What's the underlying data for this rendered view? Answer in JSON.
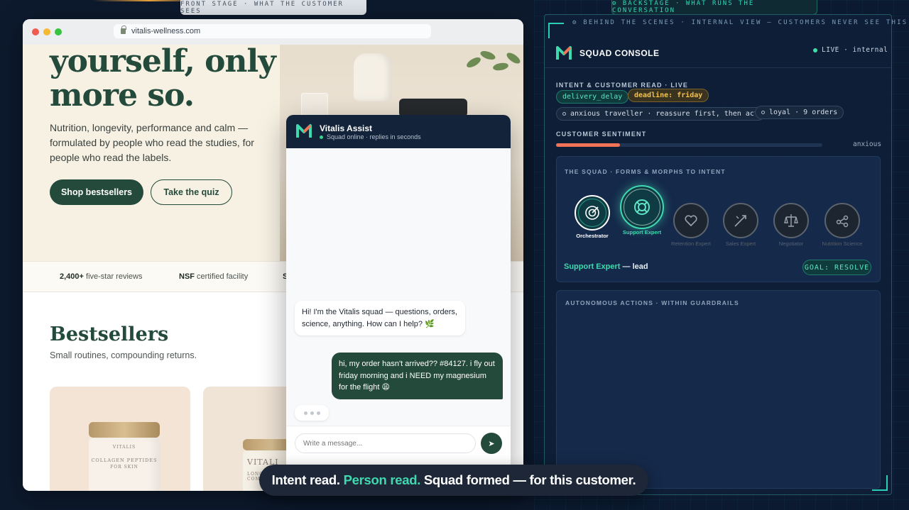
{
  "stage": {
    "front_label": "FRONT STAGE · WHAT THE CUSTOMER SEES",
    "back_label": "⚙ BACKSTAGE · WHAT RUNS THE CONVERSATION"
  },
  "browser": {
    "url": "vitalis-wellness.com"
  },
  "hero": {
    "title_line1": "yourself, only",
    "title_line2": "more so.",
    "copy": "Nutrition, longevity, performance and calm — formulated by people who read the studies, for people who read the labels.",
    "primary_cta": "Shop bestsellers",
    "secondary_cta": "Take the quiz"
  },
  "trust": {
    "reviews_bold": "2,400+",
    "reviews_text": " five-star reviews",
    "nsf_bold": "NSF",
    "nsf_text": " certified facility",
    "third_partial": "S"
  },
  "bestsellers": {
    "title": "Bestsellers",
    "subtitle": "Small routines, compounding returns.",
    "products": [
      {
        "brand": "VITALIS",
        "name": "COLLAGEN PEPTIDES",
        "sub": "FOR SKIN"
      },
      {
        "brand": "VITALI",
        "name": "LONGEVITY COMPL"
      }
    ]
  },
  "chat": {
    "name": "Vitalis Assist",
    "status": "Squad online · replies in seconds",
    "bot_message": "Hi! I'm the Vitalis squad — questions, orders, science, anything. How can I help? 🌿",
    "user_message": "hi, my order hasn't arrived?? #84127. i fly out friday morning and i NEED my magnesium for the flight 😩",
    "input_placeholder": "Write a message...",
    "send_icon": "➤"
  },
  "caption": {
    "part1": "Intent read.",
    "part2": "Person read.",
    "part3": "Squad formed — for this customer."
  },
  "console": {
    "behind_label": "⚙ BEHIND THE SCENES · INTERNAL VIEW — CUSTOMERS NEVER SEE THIS",
    "title": "SQUAD CONSOLE",
    "live": "LIVE · internal",
    "intent_label": "INTENT & CUSTOMER READ · LIVE",
    "chips": {
      "intent": "delivery_delay",
      "deadline": "deadline: friday",
      "persona": "anxious traveller · reassure first, then act",
      "loyalty": "loyal · 9 orders"
    },
    "sentiment_label": "CUSTOMER SENTIMENT",
    "sentiment_value": 0.24,
    "sentiment_word": "anxious",
    "squad_label": "THE SQUAD · FORMS & MORPHS TO INTENT",
    "agents": [
      {
        "name": "Orchestrator",
        "state": "active"
      },
      {
        "name": "Support Expert",
        "state": "lead"
      },
      {
        "name": "Retention Expert",
        "state": "idle"
      },
      {
        "name": "Sales Expert",
        "state": "idle"
      },
      {
        "name": "Negotiator",
        "state": "idle"
      },
      {
        "name": "Nutrition Science",
        "state": "idle"
      }
    ],
    "lead_name": "Support Expert",
    "lead_suffix": " — lead",
    "goal": "GOAL: RESOLVE",
    "actions_label": "AUTONOMOUS ACTIONS · WITHIN GUARDRAILS"
  },
  "colors": {
    "brand_green": "#234a3b",
    "accent_teal": "#3fd9b0",
    "amber": "#f2c14e",
    "sentiment": "#f07358"
  }
}
